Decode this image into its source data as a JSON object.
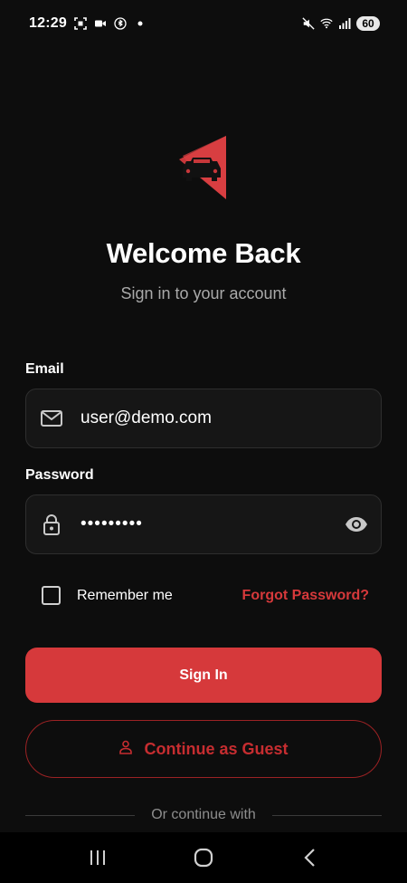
{
  "status_bar": {
    "time": "12:29",
    "battery": "60"
  },
  "header": {
    "title": "Welcome Back",
    "subtitle": "Sign in to your account"
  },
  "form": {
    "email_label": "Email",
    "email_value": "user@demo.com",
    "password_label": "Password",
    "password_value": "•••••••••",
    "remember_label": "Remember me",
    "forgot_label": "Forgot Password?",
    "signin_label": "Sign In",
    "guest_label": "Continue as Guest",
    "divider_text": "Or continue with"
  },
  "colors": {
    "accent": "#d6393b",
    "background": "#0d0d0d",
    "field_bg": "#161616"
  },
  "icons": {
    "email": "mail-icon",
    "password": "lock-icon",
    "visibility": "eye-icon",
    "guest": "person-icon"
  }
}
